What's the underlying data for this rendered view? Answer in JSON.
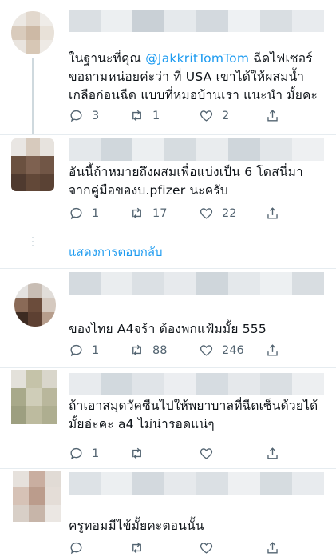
{
  "tweets": [
    {
      "text_prefix": "ในฐานะที่คุณ ",
      "mention": "@JakkritTomTom",
      "text_suffix": " ฉีดไฟเซอร์\nขอถามหน่อยค่ะว่า ที่ USA เขาได้ให้ผสมน้ำ\nเกลือก่อนฉีด  แบบที่หมอบ้านเรา แนะนำ มั้ยคะ",
      "replies": "3",
      "retweets": "1",
      "likes": "2"
    },
    {
      "text": "อันนี้ถ้าหมายถึงผสมเพื่อแบ่งเป็น 6 โดสนี่มา\nจากคู่มือของบ.pfizer นะครับ",
      "replies": "1",
      "retweets": "17",
      "likes": "22"
    },
    {
      "text": "ของไทย A4จร้า ต้องพกแฟ้มมั้ย 555",
      "replies": "1",
      "retweets": "88",
      "likes": "246"
    },
    {
      "text": "ถ้าเอาสมุดวัคซีนไปให้พยาบาลที่ฉีดเซ็นด้วยได้\nมั้ยอ่ะคะ a4 ไม่น่ารอดแน่ๆ",
      "replies": "1",
      "retweets": "",
      "likes": ""
    },
    {
      "text": "ครูทอมมีไข้มั้ยคะตอนนั้น",
      "replies": "",
      "retweets": "",
      "likes": ""
    }
  ],
  "show_replies_label": "แสดงการตอบกลับ",
  "icons": {
    "reply": "reply-icon",
    "retweet": "retweet-icon",
    "like": "like-icon",
    "share": "share-icon"
  },
  "colors": {
    "link": "#1d9bf0",
    "text": "#0f1419",
    "muted": "#536471",
    "divider": "#e6ecf0"
  }
}
